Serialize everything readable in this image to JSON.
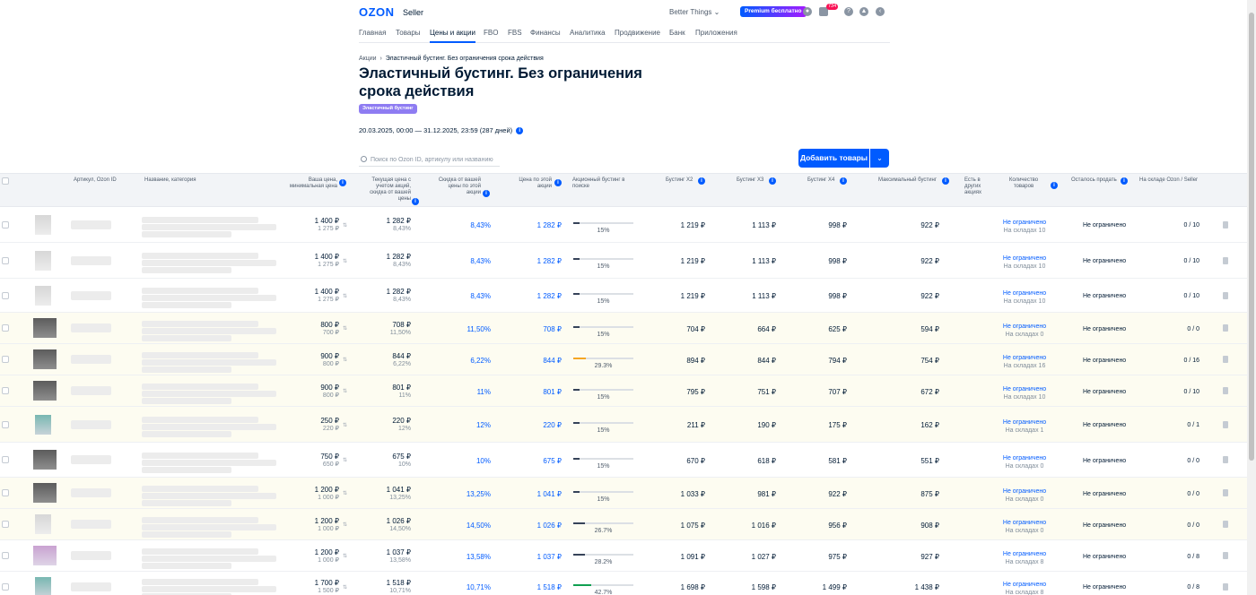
{
  "header": {
    "logo": "OZON",
    "logo_sub": "Seller",
    "store_name": "Better Things",
    "premium_label": "Premium бесплатно",
    "notifications_count": "734"
  },
  "nav": {
    "tabs": [
      {
        "label": "Главная"
      },
      {
        "label": "Товары"
      },
      {
        "label": "Цены и акции",
        "active": true
      },
      {
        "label": "FBO"
      },
      {
        "label": "FBS"
      },
      {
        "label": "Финансы"
      },
      {
        "label": "Аналитика"
      },
      {
        "label": "Продвижение"
      },
      {
        "label": "Банк"
      },
      {
        "label": "Приложения"
      }
    ]
  },
  "breadcrumb": {
    "root": "Акции",
    "current": "Эластичный бустинг. Без ограничения срока действия"
  },
  "page": {
    "title": "Эластичный бустинг. Без ограничения срока действия",
    "tag": "Эластичный бустинг",
    "dates": "20.03.2025, 00:00 — 31.12.2025, 23:59 (287 дней)"
  },
  "search": {
    "placeholder": "Поиск по Ozon ID, артикулу или названию"
  },
  "actions": {
    "add_products": "Добавить товары"
  },
  "columns": {
    "article": "Артикул, Ozon ID",
    "name": "Название, категория",
    "your_price": "Ваша цена, минимальная цена",
    "current_price": "Текущая цена с учетом акций, скидка от вашей цены",
    "discount": "Скидка от вашей цены по этой акции",
    "promo_price": "Цена по этой акции",
    "boost": "Акционный бустинг в поиске",
    "x2": "Бустинг X2",
    "x3": "Бустинг X3",
    "x4": "Бустинг X4",
    "max": "Максимальный бустинг",
    "other": "Есть в других акциях",
    "qty": "Количество товаров",
    "left": "Осталось продать",
    "stock": "На складе Ozon / Seller"
  },
  "rows": [
    {
      "price": "1 400 ₽",
      "min_price": "1 275 ₽",
      "cur": "1 282 ₽",
      "cur_disc": "8,43%",
      "disc": "8,43%",
      "promo": "1 282 ₽",
      "boost": "15%",
      "boost_level": 15,
      "x2": "1 219 ₽",
      "x3": "1 113 ₽",
      "x4": "998 ₽",
      "max": "922 ₽",
      "qty": "Не ограничено",
      "qty_wh": "На складах 10",
      "left": "Не ограничено",
      "stock": "0 / 10",
      "hl": false,
      "img": "light"
    },
    {
      "price": "1 400 ₽",
      "min_price": "1 275 ₽",
      "cur": "1 282 ₽",
      "cur_disc": "8,43%",
      "disc": "8,43%",
      "promo": "1 282 ₽",
      "boost": "15%",
      "boost_level": 15,
      "x2": "1 219 ₽",
      "x3": "1 113 ₽",
      "x4": "998 ₽",
      "max": "922 ₽",
      "qty": "Не ограничено",
      "qty_wh": "На складах 10",
      "left": "Не ограничено",
      "stock": "0 / 10",
      "hl": false,
      "img": "light"
    },
    {
      "price": "1 400 ₽",
      "min_price": "1 275 ₽",
      "cur": "1 282 ₽",
      "cur_disc": "8,43%",
      "disc": "8,43%",
      "promo": "1 282 ₽",
      "boost": "15%",
      "boost_level": 15,
      "x2": "1 219 ₽",
      "x3": "1 113 ₽",
      "x4": "998 ₽",
      "max": "922 ₽",
      "qty": "Не ограничено",
      "qty_wh": "На складах 10",
      "left": "Не ограничено",
      "stock": "0 / 10",
      "hl": false,
      "img": "light"
    },
    {
      "price": "800 ₽",
      "min_price": "700 ₽",
      "cur": "708 ₽",
      "cur_disc": "11,50%",
      "disc": "11,50%",
      "promo": "708 ₽",
      "boost": "15%",
      "boost_level": 15,
      "x2": "704 ₽",
      "x3": "664 ₽",
      "x4": "625 ₽",
      "max": "594 ₽",
      "qty": "Не ограничено",
      "qty_wh": "На складах 0",
      "left": "Не ограничено",
      "stock": "0 / 0",
      "hl": true,
      "img": "dark"
    },
    {
      "price": "900 ₽",
      "min_price": "800 ₽",
      "cur": "844 ₽",
      "cur_disc": "6,22%",
      "disc": "6,22%",
      "promo": "844 ₽",
      "boost": "29.3%",
      "boost_level": 29.3,
      "boost_color": "#f5a623",
      "x2": "894 ₽",
      "x3": "844 ₽",
      "x4": "794 ₽",
      "max": "754 ₽",
      "qty": "Не ограничено",
      "qty_wh": "На складах 16",
      "left": "Не ограничено",
      "stock": "0 / 16",
      "hl": true,
      "img": "dark"
    },
    {
      "price": "900 ₽",
      "min_price": "800 ₽",
      "cur": "801 ₽",
      "cur_disc": "11%",
      "disc": "11%",
      "promo": "801 ₽",
      "boost": "15%",
      "boost_level": 15,
      "x2": "795 ₽",
      "x3": "751 ₽",
      "x4": "707 ₽",
      "max": "672 ₽",
      "qty": "Не ограничено",
      "qty_wh": "На складах 10",
      "left": "Не ограничено",
      "stock": "0 / 10",
      "hl": true,
      "img": "dark"
    },
    {
      "price": "250 ₽",
      "min_price": "220 ₽",
      "cur": "220 ₽",
      "cur_disc": "12%",
      "disc": "12%",
      "promo": "220 ₽",
      "boost": "15%",
      "boost_level": 15,
      "x2": "211 ₽",
      "x3": "190 ₽",
      "x4": "175 ₽",
      "max": "162 ₽",
      "qty": "Не ограничено",
      "qty_wh": "На складах 1",
      "left": "Не ограничено",
      "stock": "0 / 1",
      "hl": true,
      "img": "teal"
    },
    {
      "price": "750 ₽",
      "min_price": "650 ₽",
      "cur": "675 ₽",
      "cur_disc": "10%",
      "disc": "10%",
      "promo": "675 ₽",
      "boost": "15%",
      "boost_level": 15,
      "x2": "670 ₽",
      "x3": "618 ₽",
      "x4": "581 ₽",
      "max": "551 ₽",
      "qty": "Не ограничено",
      "qty_wh": "На складах 0",
      "left": "Не ограничено",
      "stock": "0 / 0",
      "hl": false,
      "img": "dark"
    },
    {
      "price": "1 200 ₽",
      "min_price": "1 000 ₽",
      "cur": "1 041 ₽",
      "cur_disc": "13,25%",
      "disc": "13,25%",
      "promo": "1 041 ₽",
      "boost": "15%",
      "boost_level": 15,
      "x2": "1 033 ₽",
      "x3": "981 ₽",
      "x4": "922 ₽",
      "max": "875 ₽",
      "qty": "Не ограничено",
      "qty_wh": "На складах 0",
      "left": "Не ограничено",
      "stock": "0 / 0",
      "hl": true,
      "img": "dark"
    },
    {
      "price": "1 200 ₽",
      "min_price": "1 000 ₽",
      "cur": "1 026 ₽",
      "cur_disc": "14,50%",
      "disc": "14,50%",
      "promo": "1 026 ₽",
      "boost": "26.7%",
      "boost_level": 26.7,
      "x2": "1 075 ₽",
      "x3": "1 016 ₽",
      "x4": "956 ₽",
      "max": "908 ₽",
      "qty": "Не ограничено",
      "qty_wh": "На складах 0",
      "left": "Не ограничено",
      "stock": "0 / 0",
      "hl": true,
      "img": "light"
    },
    {
      "price": "1 200 ₽",
      "min_price": "1 000 ₽",
      "cur": "1 037 ₽",
      "cur_disc": "13,58%",
      "disc": "13,58%",
      "promo": "1 037 ₽",
      "boost": "28.2%",
      "boost_level": 28.2,
      "x2": "1 091 ₽",
      "x3": "1 027 ₽",
      "x4": "975 ₽",
      "max": "927 ₽",
      "qty": "Не ограничено",
      "qty_wh": "На складах 8",
      "left": "Не ограничено",
      "stock": "0 / 8",
      "hl": false,
      "img": "pink"
    },
    {
      "price": "1 700 ₽",
      "min_price": "1 500 ₽",
      "cur": "1 518 ₽",
      "cur_disc": "10,71%",
      "disc": "10,71%",
      "promo": "1 518 ₽",
      "boost": "42.7%",
      "boost_level": 42.7,
      "boost_color": "#10a050",
      "x2": "1 698 ₽",
      "x3": "1 598 ₽",
      "x4": "1 499 ₽",
      "max": "1 438 ₽",
      "qty": "Не ограничено",
      "qty_wh": "На складах 8",
      "left": "Не ограничено",
      "stock": "0 / 8",
      "hl": false,
      "img": "teal"
    }
  ]
}
